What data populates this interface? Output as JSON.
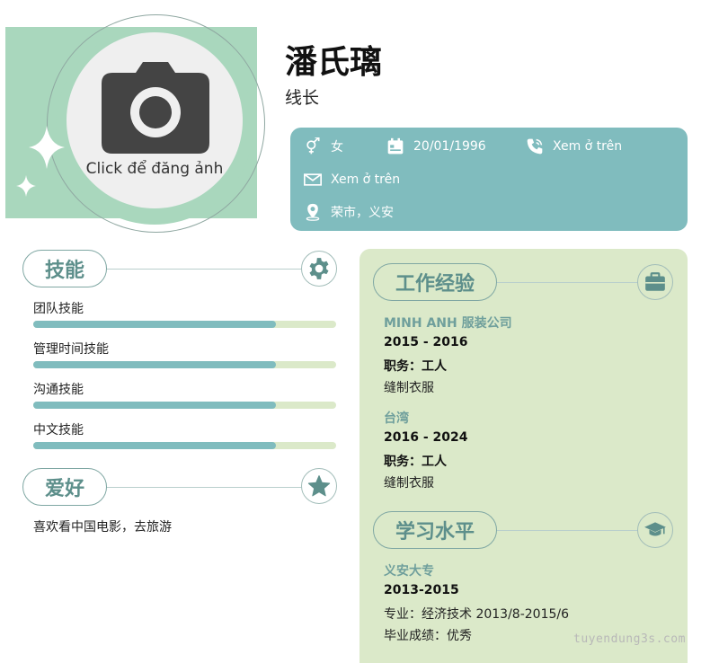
{
  "profile": {
    "name": "潘氏璃",
    "position": "线长",
    "avatar_caption": "Click để đăng ảnh"
  },
  "contact": {
    "gender": "女",
    "birthday": "20/01/1996",
    "phone": "Xem ở trên",
    "email": "Xem ở trên",
    "address": "荣市，义安"
  },
  "skills": {
    "title": "技能",
    "items": [
      {
        "label": "团队技能",
        "level": 0.8
      },
      {
        "label": "管理时间技能",
        "level": 0.8
      },
      {
        "label": "沟通技能",
        "level": 0.8
      },
      {
        "label": "中文技能",
        "level": 0.8
      }
    ]
  },
  "hobbies": {
    "title": "爱好",
    "text": "喜欢看中国电影，去旅游"
  },
  "experience": {
    "title": "工作经验",
    "items": [
      {
        "company": "MINH ANH 服装公司",
        "period": "2015 - 2016",
        "role": "职务：工人",
        "desc": "缝制衣服"
      },
      {
        "company": "台湾",
        "period": "2016 - 2024",
        "role": "职务：工人",
        "desc": "缝制衣服"
      }
    ]
  },
  "education": {
    "title": "学习水平",
    "school": "义安大专",
    "period": "2013-2015",
    "major": "专业：经济技术 2013/8-2015/6",
    "grade": "毕业成绩：优秀"
  },
  "watermark": "tuyendung3s.com",
  "colors": {
    "accent": "#80bcbe",
    "panel": "#dbe9c9",
    "avatar_green": "#a9d7bd",
    "heading_text": "#5d8f8b"
  }
}
